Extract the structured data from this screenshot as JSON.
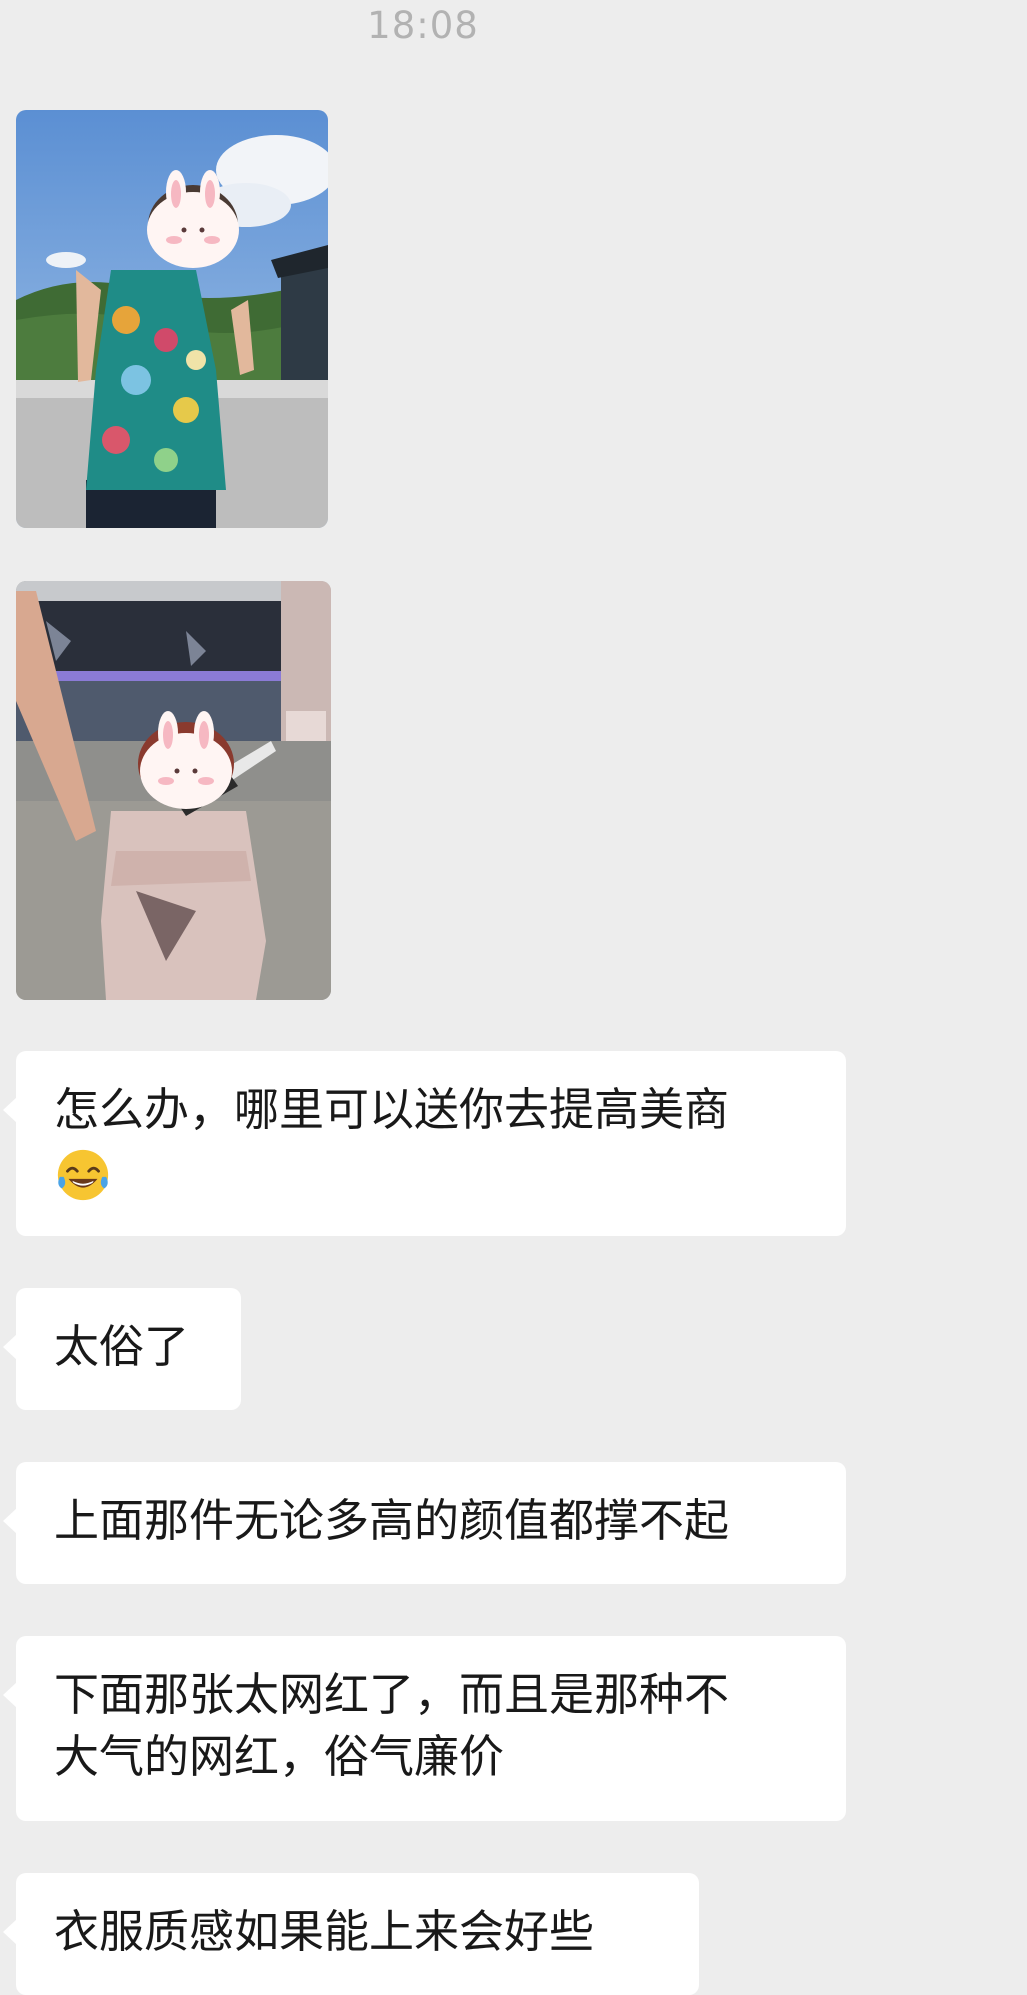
{
  "chat": {
    "timestamp": "18:08",
    "messages": [
      {
        "type": "image",
        "description": "photo"
      },
      {
        "type": "image",
        "description": "photo"
      },
      {
        "type": "text",
        "text": "怎么办，哪里可以送你去提高美商",
        "emoji": "tears-of-joy-emoji"
      },
      {
        "type": "text",
        "text": "太俗了"
      },
      {
        "type": "text",
        "text": "上面那件无论多高的颜值都撑不起"
      },
      {
        "type": "text",
        "lines": [
          "下面那张太网红了，而且是那种不",
          "大气的网红，俗气廉价"
        ]
      },
      {
        "type": "text",
        "text": "衣服质感如果能上来会好些"
      }
    ]
  },
  "colors": {
    "background": "#ededed",
    "bubble": "#ffffff",
    "text": "#191919",
    "timestamp": "#b2b2b2"
  }
}
